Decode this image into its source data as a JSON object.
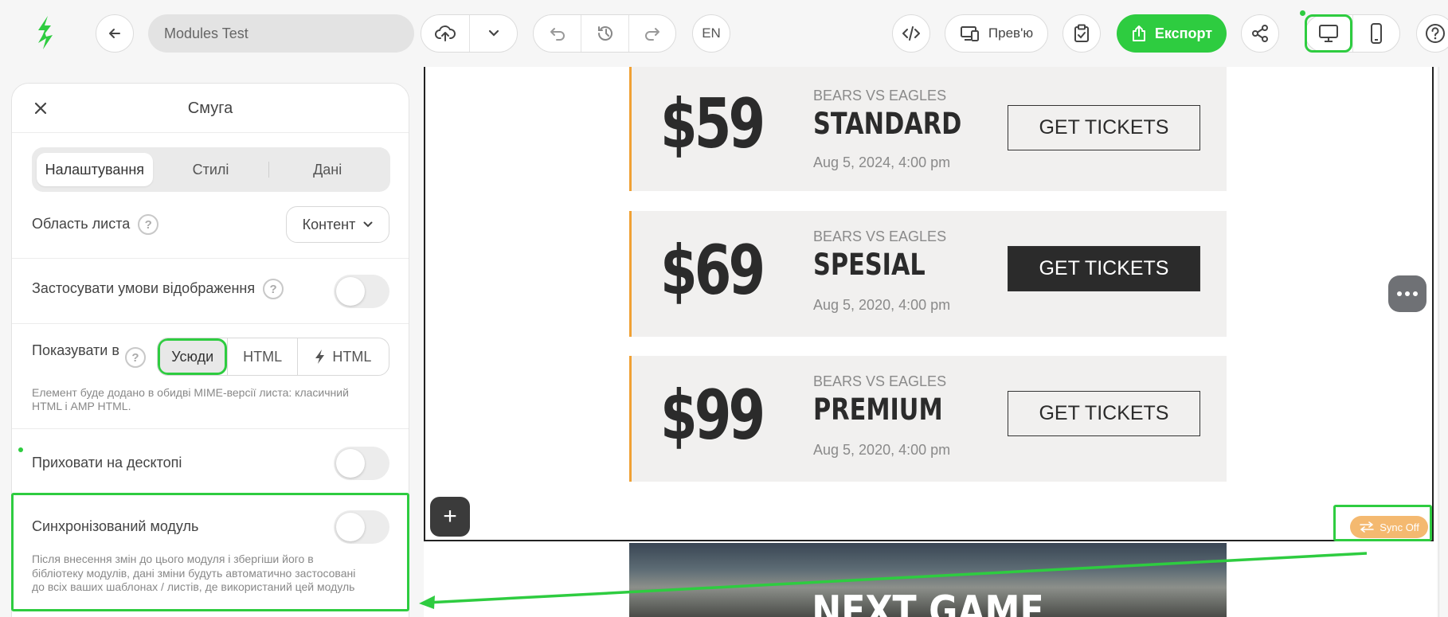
{
  "toolbar": {
    "title_value": "Modules Test",
    "lang": "EN",
    "preview_label": "Прев'ю",
    "export_label": "Експорт",
    "accent": "#2ecc40"
  },
  "panel": {
    "title": "Смуга",
    "tabs": [
      "Налаштування",
      "Стилі",
      "Дані"
    ],
    "area_label": "Область листа",
    "area_value": "Контент",
    "conditions_label": "Застосувати умови відображення",
    "show_in_label": "Показувати в",
    "show_in_options": [
      "Усюди",
      "HTML",
      "HTML"
    ],
    "show_in_hint": "Елемент буде додано в обидві MIME-версії листа: класичний HTML і AMP HTML.",
    "hide_desktop_label": "Приховати на десктопі",
    "synced_label": "Синхронізований модуль",
    "synced_hint": "Після внесення змін до цього модуля і збергіши його в бібліотеку модулів, дані зміни будуть автоматично застосовані до всіх ваших шаблонах / листів, де використаний цей модуль"
  },
  "canvas": {
    "tickets": [
      {
        "price": "$59",
        "match": "BEARS VS EAGLES",
        "tier": "STANDARD",
        "date": "Aug 5, 2024, 4:00 pm",
        "button": "GET TICKETS",
        "dark": false
      },
      {
        "price": "$69",
        "match": "BEARS VS EAGLES",
        "tier": "SPESIAL",
        "date": "Aug 5, 2020, 4:00 pm",
        "button": "GET TICKETS",
        "dark": true
      },
      {
        "price": "$99",
        "match": "BEARS VS EAGLES",
        "tier": "PREMIUM",
        "date": "Aug 5, 2020, 4:00 pm",
        "button": "GET TICKETS",
        "dark": false
      }
    ],
    "sync_badge": "Sync Off",
    "next_game": "NEXT GAME",
    "add_symbol": "+"
  }
}
